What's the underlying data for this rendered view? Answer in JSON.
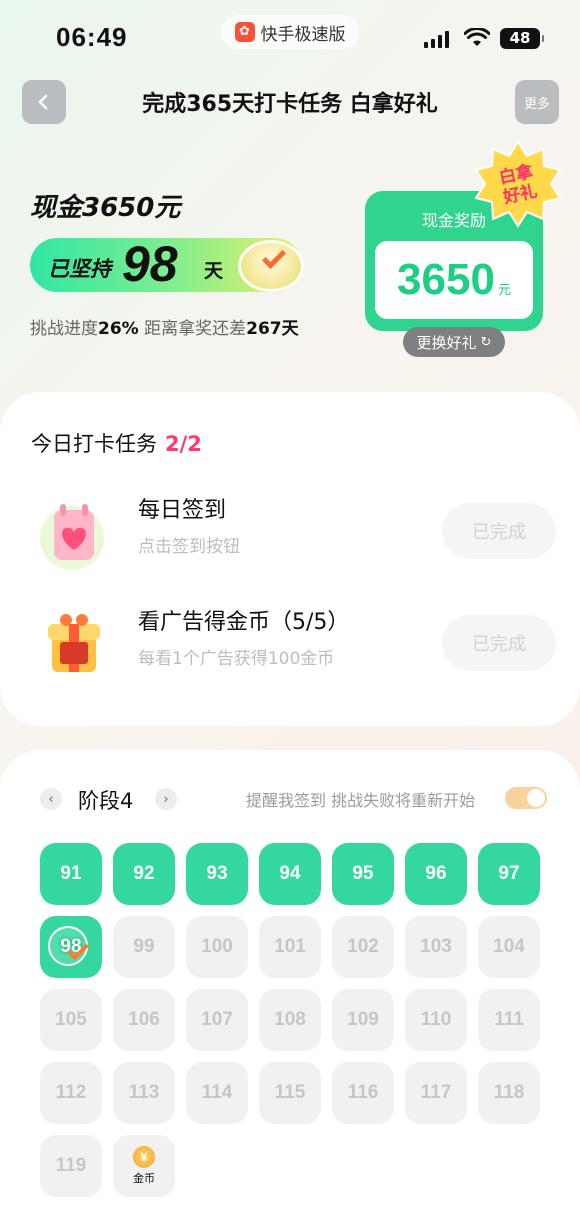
{
  "status_bar": {
    "time": "06:49",
    "app_name": "快手极速版",
    "battery": "48"
  },
  "header": {
    "title": "完成365天打卡任务 白拿好礼",
    "more_label": "更多"
  },
  "hero": {
    "cash_title": "现金3650元",
    "streak_prefix": "已坚持",
    "streak_days": "98",
    "streak_unit": "天",
    "progress_label": "挑战进度",
    "progress_value": "26%",
    "remaining_label": "距离拿奖还差",
    "remaining_value": "267天"
  },
  "reward": {
    "label": "现金奖励",
    "amount": "3650",
    "unit": "元",
    "badge_line1": "白拿",
    "badge_line2": "好礼",
    "change_label": "更换好礼"
  },
  "today_tasks": {
    "title": "今日打卡任务",
    "count": "2/2",
    "items": [
      {
        "name": "每日签到",
        "desc": "点击签到按钮",
        "button": "已完成",
        "icon": "calendar-heart-icon"
      },
      {
        "name": "看广告得金币（5/5）",
        "desc": "每看1个广告获得100金币",
        "button": "已完成",
        "icon": "gift-box-icon"
      }
    ]
  },
  "stage": {
    "label": "阶段4",
    "remind_text": "提醒我签到 挑战失败将重新开始",
    "remind_on": true,
    "days": [
      {
        "label": "91",
        "state": "done"
      },
      {
        "label": "92",
        "state": "done"
      },
      {
        "label": "93",
        "state": "done"
      },
      {
        "label": "94",
        "state": "done"
      },
      {
        "label": "95",
        "state": "done"
      },
      {
        "label": "96",
        "state": "done"
      },
      {
        "label": "97",
        "state": "done"
      },
      {
        "label": "98",
        "state": "today"
      },
      {
        "label": "99",
        "state": "todo"
      },
      {
        "label": "100",
        "state": "todo"
      },
      {
        "label": "101",
        "state": "todo"
      },
      {
        "label": "102",
        "state": "todo"
      },
      {
        "label": "103",
        "state": "todo"
      },
      {
        "label": "104",
        "state": "todo"
      },
      {
        "label": "105",
        "state": "todo"
      },
      {
        "label": "106",
        "state": "todo"
      },
      {
        "label": "107",
        "state": "todo"
      },
      {
        "label": "108",
        "state": "todo"
      },
      {
        "label": "109",
        "state": "todo"
      },
      {
        "label": "110",
        "state": "todo"
      },
      {
        "label": "111",
        "state": "todo"
      },
      {
        "label": "112",
        "state": "todo"
      },
      {
        "label": "113",
        "state": "todo"
      },
      {
        "label": "114",
        "state": "todo"
      },
      {
        "label": "115",
        "state": "todo"
      },
      {
        "label": "116",
        "state": "todo"
      },
      {
        "label": "117",
        "state": "todo"
      },
      {
        "label": "118",
        "state": "todo"
      },
      {
        "label": "119",
        "state": "todo"
      },
      {
        "label": "金币",
        "state": "coin"
      }
    ]
  },
  "colors": {
    "accent_green": "#34d89e",
    "count_pink": "#ff3b6b",
    "toggle_on": "#fad39c"
  }
}
